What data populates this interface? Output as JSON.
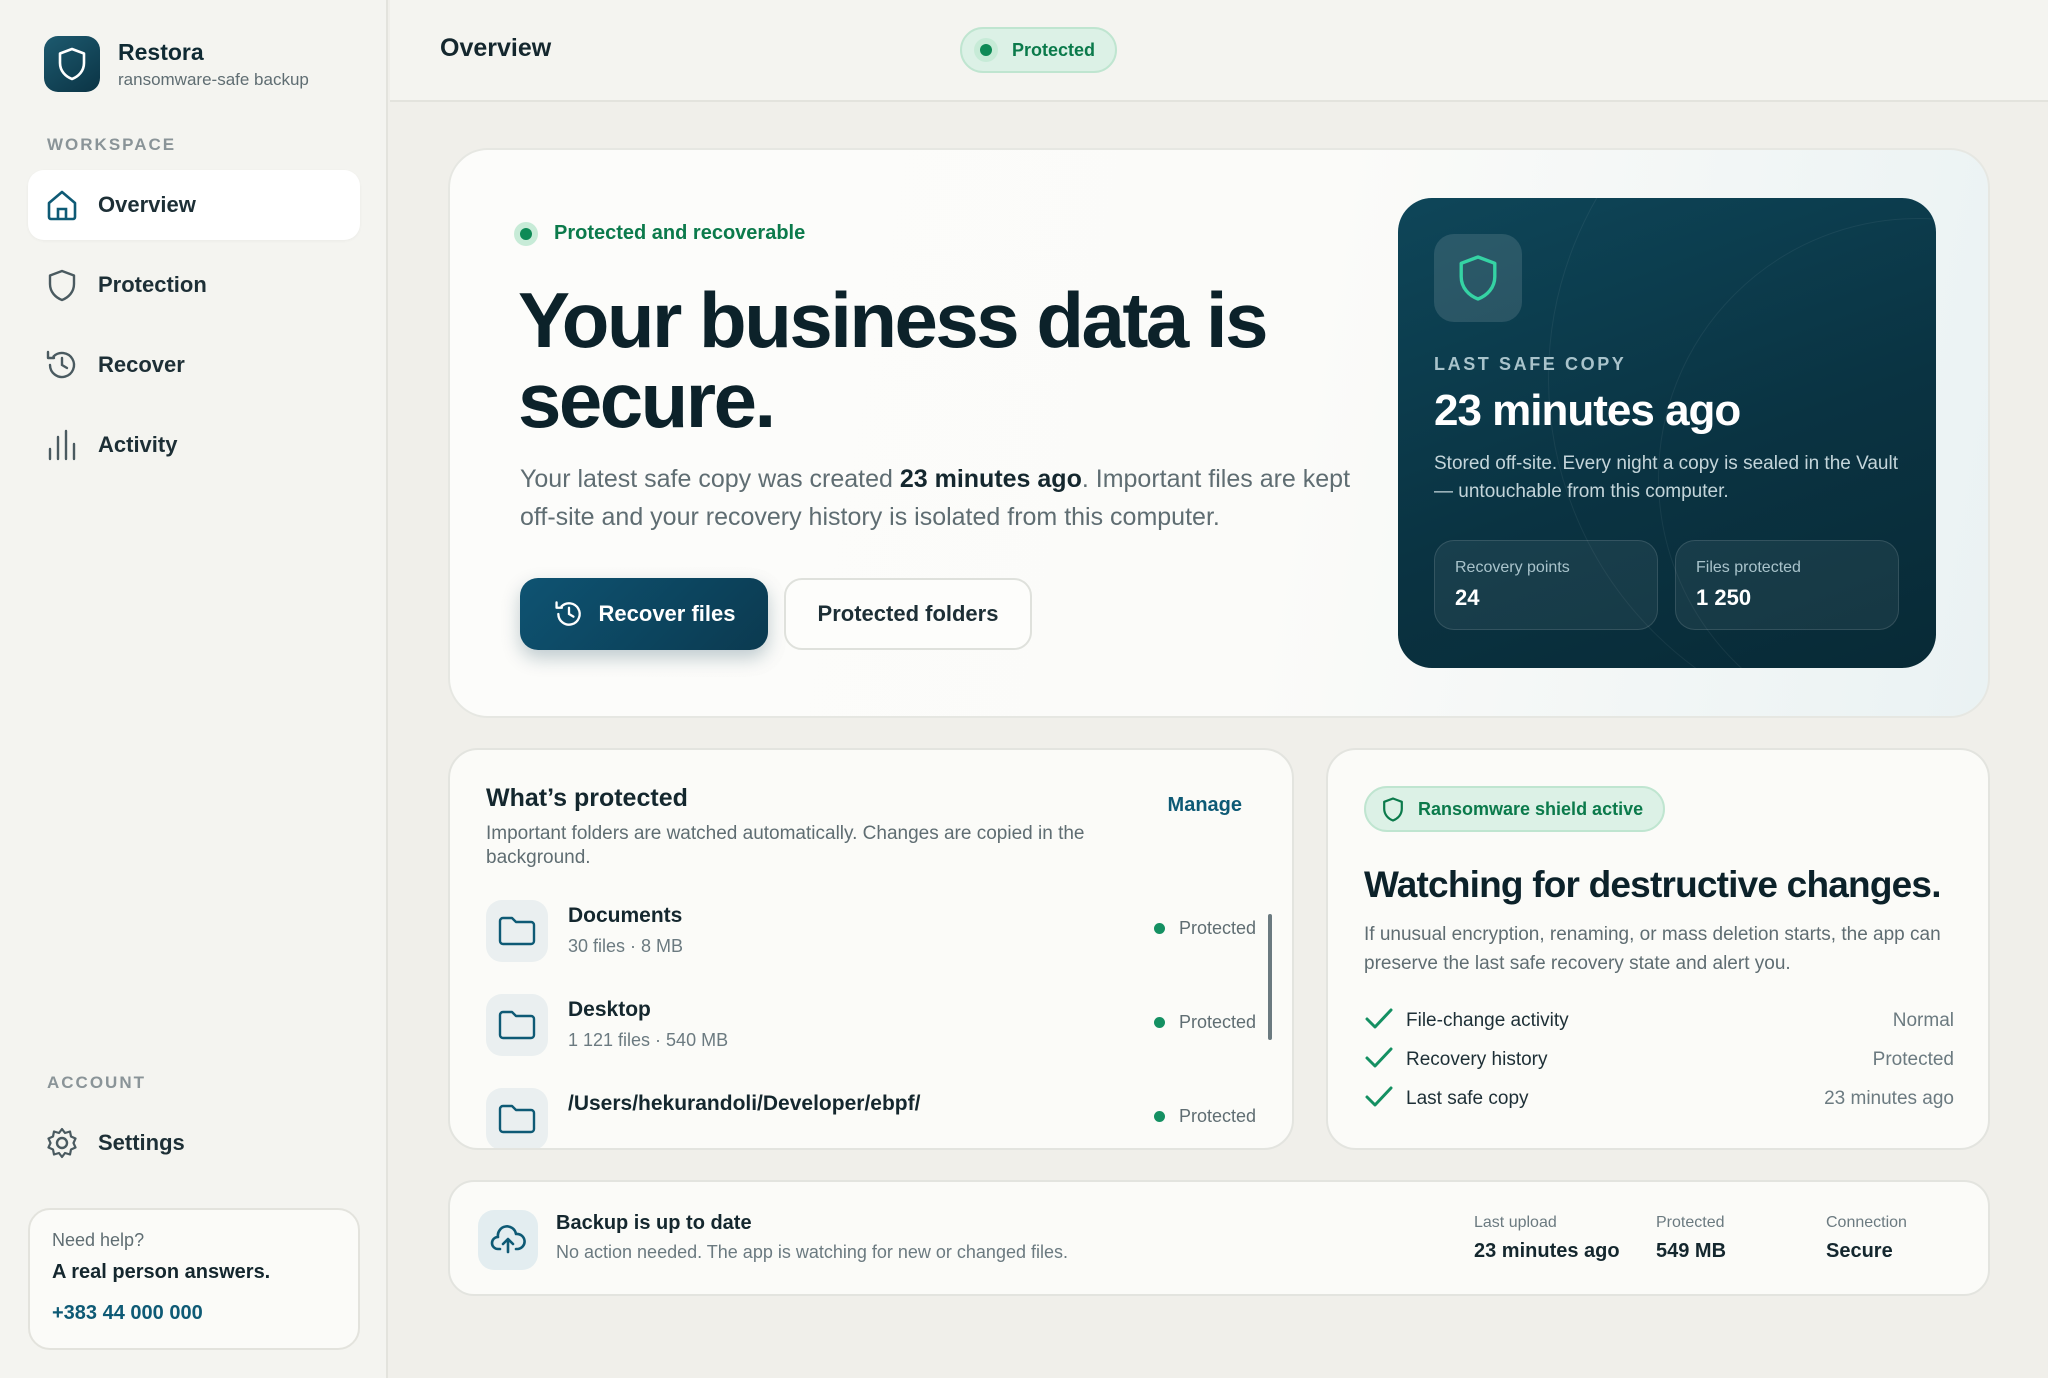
{
  "brand": {
    "name": "Restora",
    "tagline": "ransomware-safe backup"
  },
  "sidebar": {
    "workspace_label": "WORKSPACE",
    "items": [
      {
        "label": "Overview",
        "icon": "home-icon"
      },
      {
        "label": "Protection",
        "icon": "shield-icon"
      },
      {
        "label": "Recover",
        "icon": "history-icon"
      },
      {
        "label": "Activity",
        "icon": "activity-icon"
      }
    ],
    "account_label": "ACCOUNT",
    "settings_label": "Settings",
    "help": {
      "question": "Need help?",
      "answer": "A real person answers.",
      "phone": "+383 44 000 000"
    }
  },
  "header": {
    "title": "Overview",
    "badge": "Protected"
  },
  "hero": {
    "status": "Protected and recoverable",
    "title": "Your business data is secure.",
    "desc_pre": "Your latest safe copy was created ",
    "desc_bold": "23 minutes ago",
    "desc_post": ". Important files are kept off-site and your recovery history is isolated from this computer.",
    "primary_button": "Recover files",
    "secondary_button": "Protected folders"
  },
  "vault": {
    "label": "LAST SAFE COPY",
    "time": "23 minutes ago",
    "desc": "Stored off-site. Every night a copy is sealed in the Vault — untouchable from this computer.",
    "stats": [
      {
        "label": "Recovery points",
        "value": "24"
      },
      {
        "label": "Files protected",
        "value": "1 250"
      }
    ]
  },
  "whats_protected": {
    "title": "What’s protected",
    "desc": "Important folders are watched automatically. Changes are copied in the background.",
    "manage_label": "Manage",
    "folders": [
      {
        "name": "Documents",
        "meta": "30 files · 8 MB",
        "status": "Protected"
      },
      {
        "name": "Desktop",
        "meta": "1 121 files · 540 MB",
        "status": "Protected"
      },
      {
        "name": "/Users/hekurandoli/Developer/ebpf/",
        "meta": "",
        "status": "Protected"
      }
    ]
  },
  "shield": {
    "badge": "Ransomware shield active",
    "title": "Watching for destructive changes.",
    "desc": "If unusual encryption, renaming, or mass deletion starts, the app can preserve the last safe recovery state and alert you.",
    "checks": [
      {
        "label": "File-change activity",
        "value": "Normal"
      },
      {
        "label": "Recovery history",
        "value": "Protected"
      },
      {
        "label": "Last safe copy",
        "value": "23 minutes ago"
      }
    ]
  },
  "status_bar": {
    "title": "Backup is up to date",
    "subtitle": "No action needed. The app is watching for new or changed files.",
    "stats": [
      {
        "label": "Last upload",
        "value": "23 minutes ago"
      },
      {
        "label": "Protected",
        "value": "549 MB"
      },
      {
        "label": "Connection",
        "value": "Secure"
      }
    ]
  },
  "colors": {
    "accent": "#0e5a75",
    "success": "#0e8a56",
    "dark_card": "#0a3342"
  }
}
